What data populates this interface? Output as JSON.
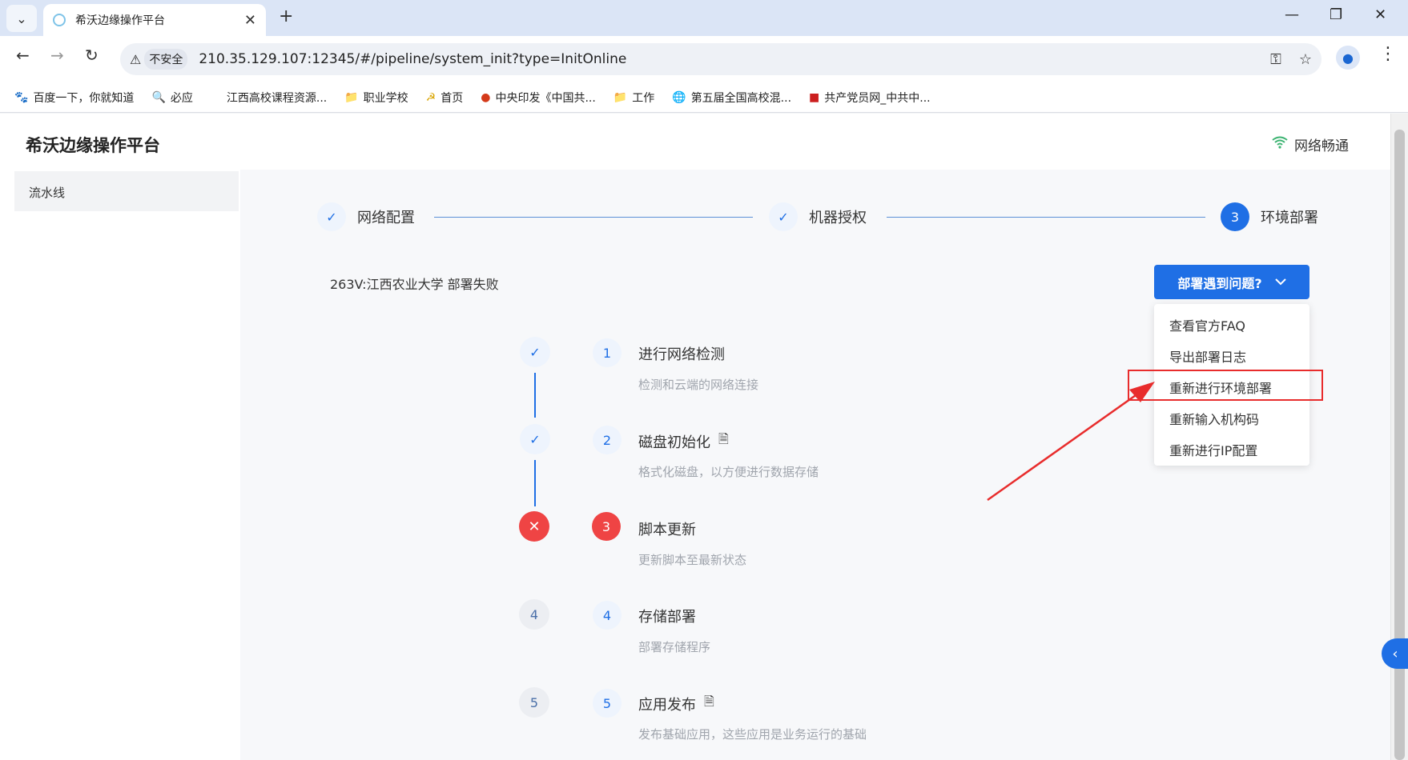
{
  "browser": {
    "tab_title": "希沃边缘操作平台",
    "tab_close": "✕",
    "new_tab": "+",
    "win_min": "—",
    "win_restore": "❐",
    "win_close": "✕",
    "insecure_label": "不安全",
    "url": "210.35.129.107:12345/#/pipeline/system_init?type=InitOnline",
    "bookmarks": [
      {
        "label": "百度一下，你就知道",
        "icon": "🐾"
      },
      {
        "label": "必应",
        "icon": "🔍"
      },
      {
        "label": "江西高校课程资源...",
        "icon": ""
      },
      {
        "label": "职业学校",
        "icon": "📁"
      },
      {
        "label": "首页",
        "icon": "☭"
      },
      {
        "label": "中央印发《中国共...",
        "icon": "●"
      },
      {
        "label": "工作",
        "icon": "📁"
      },
      {
        "label": "第五届全国高校混...",
        "icon": "🌐"
      },
      {
        "label": "共产党员网_中共中...",
        "icon": "■"
      }
    ]
  },
  "app": {
    "title": "希沃边缘操作平台",
    "network_status": "网络畅通",
    "sidebar": {
      "items": [
        {
          "label": "流水线"
        }
      ]
    },
    "steps": [
      {
        "label": "网络配置",
        "state": "done",
        "icon": "✓"
      },
      {
        "label": "机器授权",
        "state": "done",
        "icon": "✓"
      },
      {
        "label": "环境部署",
        "state": "active",
        "number": "3"
      }
    ],
    "deploy_status": "263V:江西农业大学 部署失败",
    "problem_button": "部署遇到问题?",
    "problem_menu": [
      "查看官方FAQ",
      "导出部署日志",
      "重新进行环境部署",
      "重新输入机构码",
      "重新进行IP配置"
    ],
    "highlighted_menu_item": "重新进行环境部署",
    "pipeline": [
      {
        "number": "1",
        "title": "进行网络检测",
        "desc": "检测和云端的网络连接",
        "state": "done",
        "icon": "✓",
        "has_doc": false
      },
      {
        "number": "2",
        "title": "磁盘初始化",
        "desc": "格式化磁盘，以方便进行数据存储",
        "state": "done",
        "icon": "✓",
        "has_doc": true
      },
      {
        "number": "3",
        "title": "脚本更新",
        "desc": "更新脚本至最新状态",
        "state": "fail",
        "icon": "✕",
        "has_doc": false
      },
      {
        "number": "4",
        "title": "存储部署",
        "desc": "部署存储程序",
        "state": "wait",
        "icon": "4",
        "has_doc": false
      },
      {
        "number": "5",
        "title": "应用发布",
        "desc": "发布基础应用，这些应用是业务运行的基础",
        "state": "wait",
        "icon": "5",
        "has_doc": true
      }
    ]
  },
  "colors": {
    "primary": "#1f6fe5",
    "danger": "#ef4444",
    "annotation": "#e82c2c",
    "network_ok": "#3cb371"
  }
}
